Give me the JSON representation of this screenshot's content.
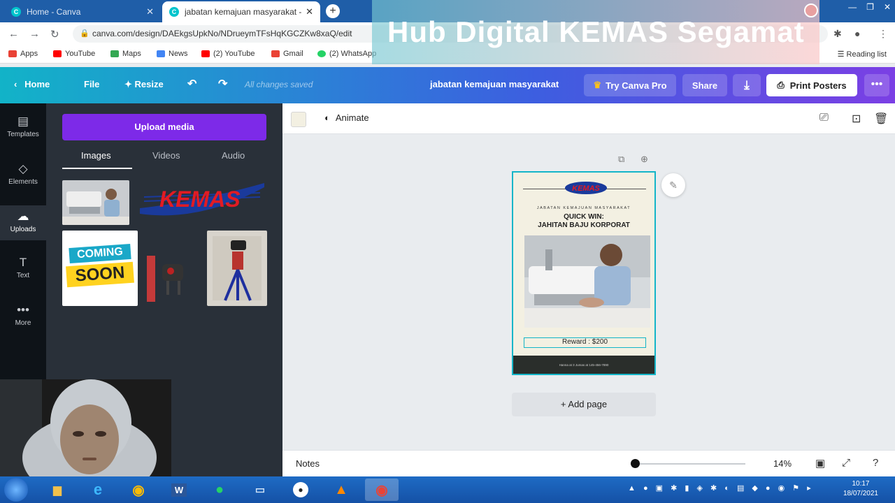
{
  "browser": {
    "tabs": [
      {
        "title": "Home - Canva"
      },
      {
        "title": "jabatan kemajuan masyarakat - P"
      }
    ],
    "url": "canva.com/design/DAEkgsUpkNo/NDrueymTFsHqKGCZKw8xaQ/edit",
    "bookmarks": [
      "Apps",
      "YouTube",
      "Maps",
      "News",
      "(2) YouTube",
      "Gmail",
      "(2) WhatsApp"
    ],
    "reading_list": "Reading list"
  },
  "overlay": {
    "text": "Hub Digital KEMAS Segamat"
  },
  "canva_header": {
    "home": "Home",
    "file": "File",
    "resize": "Resize",
    "saved_status": "All changes saved",
    "design_title": "jabatan kemajuan masyarakat",
    "try_pro": "Try Canva Pro",
    "share": "Share",
    "print": "Print Posters"
  },
  "rail": {
    "items": [
      {
        "label": "Templates",
        "icon": "templates-icon"
      },
      {
        "label": "Elements",
        "icon": "elements-icon"
      },
      {
        "label": "Uploads",
        "icon": "cloud-upload-icon"
      },
      {
        "label": "Text",
        "icon": "text-icon"
      },
      {
        "label": "More",
        "icon": "more-icon"
      }
    ]
  },
  "panel": {
    "upload_button": "Upload media",
    "tabs": [
      "Images",
      "Videos",
      "Audio"
    ],
    "thumbs": {
      "kemas_logo": "KEMAS",
      "coming_soon_line1": "COMING",
      "coming_soon_line2": "SOON"
    }
  },
  "toolbar": {
    "animate": "Animate"
  },
  "poster": {
    "logo": "KEMAS",
    "dept": "JABATAN KEMAJUAN MASYARAKAT",
    "title_line1": "QUICK WIN:",
    "title_line2": "JAHITAN BAJU KORPORAT",
    "reward": "Reward : $200",
    "footer": "Hanna at 3 Jumas at 145-456-7890"
  },
  "editor": {
    "add_page": "+ Add page"
  },
  "footer": {
    "notes": "Notes",
    "zoom": "14%",
    "zoom_level_fraction": 0.14
  },
  "taskbar": {
    "time": "10:17",
    "date": "18/07/2021"
  },
  "colors": {
    "accent_purple": "#7d2ae8",
    "canva_teal": "#13b5c8",
    "kemas_red": "#e21b23",
    "panel_bg": "#293039"
  }
}
